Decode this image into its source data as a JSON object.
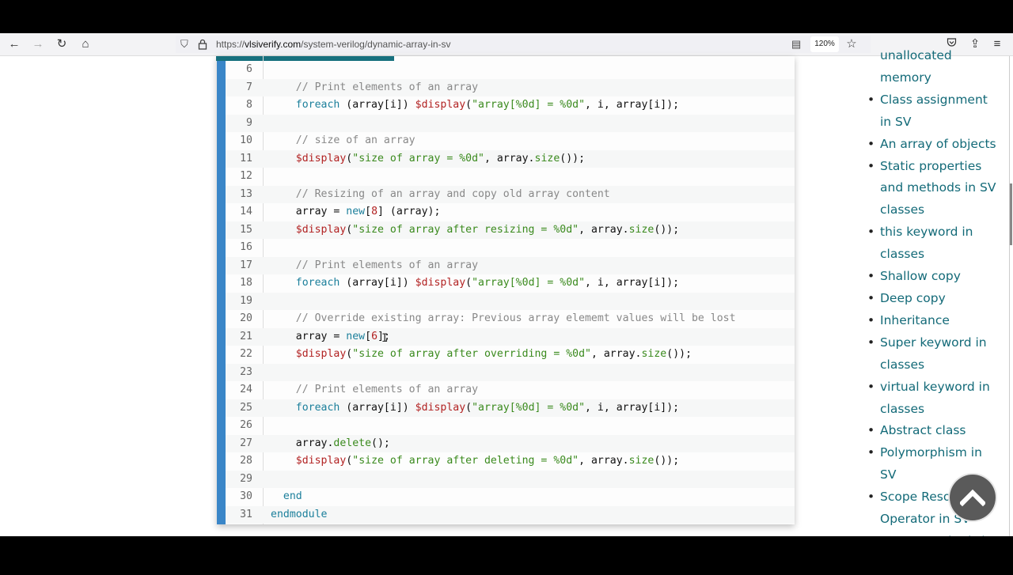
{
  "browser": {
    "url_prefix": "https://",
    "url_domain": "vlsiverify.com",
    "url_path": "/system-verilog/dynamic-array-in-sv",
    "zoom_level": "120%",
    "icons": {
      "back": "←",
      "forward": "→",
      "reload": "↻",
      "home": "⌂",
      "shield": "⛉",
      "lock": "🔒",
      "reader": "▤",
      "star": "☆",
      "pocket": "⛉",
      "extensions": "⇪",
      "menu": "≡"
    }
  },
  "code": {
    "lines": [
      {
        "n": "6",
        "html": ""
      },
      {
        "n": "7",
        "html": "    <span class=\"c-com\">// Print elements of an array</span>"
      },
      {
        "n": "8",
        "html": "    <span class=\"c-kw\">foreach</span> (array[i]) <span class=\"c-sys\">$display</span>(<span class=\"c-str\">\"array[%0d] = %0d\"</span>, i, array[i]);"
      },
      {
        "n": "9",
        "html": ""
      },
      {
        "n": "10",
        "html": "    <span class=\"c-com\">// size of an array</span>"
      },
      {
        "n": "11",
        "html": "    <span class=\"c-sys\">$display</span>(<span class=\"c-str\">\"size of array = %0d\"</span>, array.<span class=\"c-fn\">size</span>());"
      },
      {
        "n": "12",
        "html": ""
      },
      {
        "n": "13",
        "html": "    <span class=\"c-com\">// Resizing of an array and copy old array content</span>"
      },
      {
        "n": "14",
        "html": "    array = <span class=\"c-kw\">new</span>[<span class=\"c-num\">8</span>] (array);"
      },
      {
        "n": "15",
        "html": "    <span class=\"c-sys\">$display</span>(<span class=\"c-str\">\"size of array after resizing = %0d\"</span>, array.<span class=\"c-fn\">size</span>());"
      },
      {
        "n": "16",
        "html": ""
      },
      {
        "n": "17",
        "html": "    <span class=\"c-com\">// Print elements of an array</span>"
      },
      {
        "n": "18",
        "html": "    <span class=\"c-kw\">foreach</span> (array[i]) <span class=\"c-sys\">$display</span>(<span class=\"c-str\">\"array[%0d] = %0d\"</span>, i, array[i]);"
      },
      {
        "n": "19",
        "html": ""
      },
      {
        "n": "20",
        "html": "    <span class=\"c-com\">// Override existing array: Previous array elememt values will be lost</span>"
      },
      {
        "n": "21",
        "html": "    array = <span class=\"c-kw\">new</span>[<span class=\"c-num\">6</span>];"
      },
      {
        "n": "22",
        "html": "    <span class=\"c-sys\">$display</span>(<span class=\"c-str\">\"size of array after overriding = %0d\"</span>, array.<span class=\"c-fn\">size</span>());"
      },
      {
        "n": "23",
        "html": ""
      },
      {
        "n": "24",
        "html": "    <span class=\"c-com\">// Print elements of an array</span>"
      },
      {
        "n": "25",
        "html": "    <span class=\"c-kw\">foreach</span> (array[i]) <span class=\"c-sys\">$display</span>(<span class=\"c-str\">\"array[%0d] = %0d\"</span>, i, array[i]);"
      },
      {
        "n": "26",
        "html": ""
      },
      {
        "n": "27",
        "html": "    array.<span class=\"c-fn\">delete</span>();"
      },
      {
        "n": "28",
        "html": "    <span class=\"c-sys\">$display</span>(<span class=\"c-str\">\"size of array after deleting = %0d\"</span>, array.<span class=\"c-fn\">size</span>());"
      },
      {
        "n": "29",
        "html": ""
      },
      {
        "n": "30",
        "html": "  <span class=\"c-kw\">end</span>"
      },
      {
        "n": "31",
        "html": "<span class=\"c-kw\">endmodule</span>"
      }
    ]
  },
  "sidebar": {
    "items": [
      {
        "label": "unallocated memory",
        "cut": true
      },
      {
        "label": "Class assignment in SV"
      },
      {
        "label": "An array of objects"
      },
      {
        "label": "Static properties and methods in SV classes"
      },
      {
        "label": "this keyword in classes"
      },
      {
        "label": "Shallow copy"
      },
      {
        "label": "Deep copy"
      },
      {
        "label": "Inheritance"
      },
      {
        "label": "Super keyword in classes"
      },
      {
        "label": "virtual keyword in classes"
      },
      {
        "label": "Abstract class"
      },
      {
        "label": "Polymorphism in SV"
      },
      {
        "label": "Scope Resolution Operator in SV"
      },
      {
        "label": "Extern methods in Classes"
      }
    ]
  },
  "scroll_to_top": {
    "icon": "chevron-up"
  }
}
